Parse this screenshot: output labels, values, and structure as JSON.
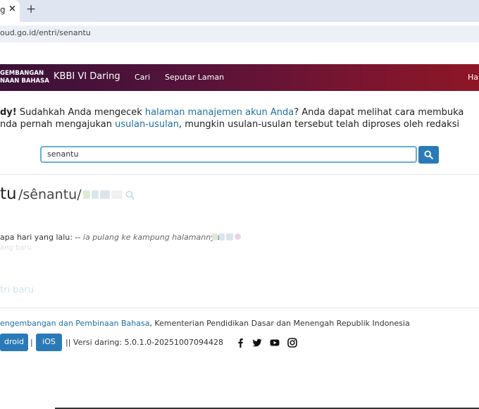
{
  "browser": {
    "tab_title": "g",
    "tab_close": "×",
    "new_tab": "+",
    "url": "oud.go.id/entri/senantu"
  },
  "header": {
    "org_line1": "GEMBANGAN",
    "org_line2": "NAAN BAHASA",
    "brand": "KBBI VI Daring",
    "nav": [
      "Cari",
      "Seputar Laman",
      "Hal"
    ]
  },
  "notice": {
    "line1_bold": "dy!",
    "line1_a": " Sudahkah Anda mengecek ",
    "line1_link": "halaman manajemen akun Anda",
    "line1_b": "? Anda dapat melihat cara membuka",
    "line2_a": "nda pernah mengajukan ",
    "line2_link": "usulan-usulan",
    "line2_b": ", mungkin usulan-usulan tersebut telah diproses oleh redaksi"
  },
  "search": {
    "value": "senantu",
    "button_icon": "search-icon"
  },
  "entry": {
    "word": "tu",
    "pronunciation": "/sênantu/",
    "example_prefix": "apa hari yang lalu: -- ",
    "example_text": "ia pulang ke kampung halamannya",
    "faded_text1": "ang baru",
    "faded_text2": "tri baru"
  },
  "footer": {
    "org_link": "engembangan dan Pembinaan Bahasa",
    "org_rest": ", Kementerian Pendidikan Dasar dan Menengah Republik Indonesia",
    "android": "droid",
    "sep": "|",
    "ios": "iOS",
    "version": "|| Versi daring: 5.0.1.0-20251007094428",
    "social_icons": [
      "facebook-icon",
      "twitter-icon",
      "youtube-icon",
      "instagram-icon"
    ]
  },
  "colors": {
    "header_gradient_start": "#3a1238",
    "header_gradient_end": "#8e1626",
    "link": "#1d6fa5",
    "button": "#2b7ab8"
  }
}
